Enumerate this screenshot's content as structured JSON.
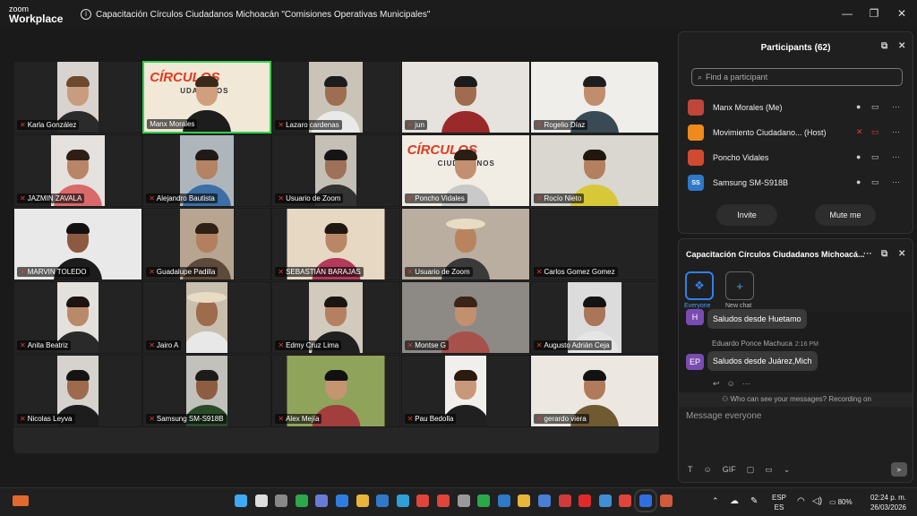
{
  "app": {
    "brand_top": "zoom",
    "brand_bottom": "Workplace",
    "title": "Capacitación Círculos Ciudadanos Michoacán \"Comisiones Operativas Municipales\""
  },
  "window_controls": {
    "minimize": "—",
    "restore": "❐",
    "close": "✕"
  },
  "tiles": [
    {
      "name": "Karla González",
      "video": "person",
      "bg": "#d8d3cf",
      "skin": "#c99b7f",
      "shirt": "#2b2b2b",
      "hair": "#6d4a2e",
      "vw": 0.32
    },
    {
      "name": "Manx Morales",
      "video": "logo",
      "bg": "#f1e8d8",
      "skin": "#d0a07e",
      "shirt": "#1d1d1d",
      "hair": "#3a2a1a",
      "vw": 1,
      "active": true,
      "logo_text": "CÍRCULOS",
      "logo_sub": "UDADANOS"
    },
    {
      "name": "Lazaro cardenas",
      "video": "person",
      "bg": "#c9c4b7",
      "skin": "#9d6e52",
      "shirt": "#e9e9e9",
      "hair": "#1c1c1c",
      "vw": 0.42
    },
    {
      "name": "jun",
      "video": "person",
      "bg": "#e6e2dd",
      "skin": "#a06b4e",
      "shirt": "#9a2a2a",
      "hair": "#1b1b1b",
      "vw": 1
    },
    {
      "name": "Rogelio Díaz",
      "video": "person",
      "bg": "#efeeea",
      "skin": "#c08d6d",
      "shirt": "#3a4a55",
      "hair": "#1e1e1e",
      "vw": 1
    },
    {
      "name": "JAZMIN ZAVALA",
      "video": "person",
      "bg": "#e4e1de",
      "skin": "#b98568",
      "shirt": "#d96a6a",
      "hair": "#2d1f15",
      "vw": 0.42
    },
    {
      "name": "Alejandro Bautista",
      "video": "person",
      "bg": "#aeb6bc",
      "skin": "#b48363",
      "shirt": "#3d6ea6",
      "hair": "#1f1a17",
      "vw": 0.42
    },
    {
      "name": "Usuario de Zoom",
      "video": "person",
      "bg": "#c4c0b6",
      "skin": "#a0715a",
      "shirt": "#333333",
      "hair": "#151515",
      "vw": 0.32
    },
    {
      "name": "Poncho Vidales",
      "video": "logo",
      "bg": "#f2ede4",
      "skin": "#c29070",
      "shirt": "#c9c9c9",
      "hair": "#2a1e14",
      "vw": 1,
      "logo_text": "CÍRCULOS",
      "logo_sub": "CIUDADANOS"
    },
    {
      "name": "Rocío Nieto",
      "video": "person",
      "bg": "#d9d7cf",
      "skin": "#b27f5f",
      "shirt": "#d7c83a",
      "hair": "#21170f",
      "vw": 1
    },
    {
      "name": "MARVIN TOLEDO",
      "video": "person",
      "bg": "#e9e9e9",
      "skin": "#8c5a40",
      "shirt": "#1c1c1c",
      "hair": "#111111",
      "vw": 1
    },
    {
      "name": "Guadalupe Padilla",
      "video": "person",
      "bg": "#b8a591",
      "skin": "#b3805f",
      "shirt": "#5c4a3a",
      "hair": "#2e2015",
      "vw": 0.42
    },
    {
      "name": "SEBASTIÁN BARAJAS",
      "video": "person",
      "bg": "#e7d8c4",
      "skin": "#b98766",
      "shirt": "#b23a5a",
      "hair": "#1f1712",
      "vw": 0.76
    },
    {
      "name": "Usuario de Zoom",
      "video": "hat",
      "bg": "#b9aea0",
      "skin": "#b8845e",
      "shirt": "#3a3a3a",
      "hair": "#e9dcc4",
      "vw": 1
    },
    {
      "name": "Carlos Gomez Gomez",
      "video": "none",
      "bg": "#262626",
      "vw": 0
    },
    {
      "name": "Anita Beatriz",
      "video": "person",
      "bg": "#e4e1dc",
      "skin": "#b98a6a",
      "shirt": "#2a2a2a",
      "hair": "#1b1410",
      "vw": 0.32
    },
    {
      "name": "Jairo A",
      "video": "hat",
      "bg": "#c9bfae",
      "skin": "#9e6b4c",
      "shirt": "#e8e8e8",
      "hair": "#e9dcc4",
      "vw": 0.32
    },
    {
      "name": "Edmy Cruz Lima",
      "video": "person",
      "bg": "#d2cbbd",
      "skin": "#b48061",
      "shirt": "#202020",
      "hair": "#1c1410",
      "vw": 0.42
    },
    {
      "name": "Montse G",
      "video": "person",
      "bg": "#8d8a86",
      "skin": "#c3906e",
      "shirt": "#a6524a",
      "hair": "#3a2416",
      "vw": 1
    },
    {
      "name": "Augusto Adrián Ceja",
      "video": "person",
      "bg": "#dcdcdc",
      "skin": "#a97658",
      "shirt": "#e5e5e5",
      "hair": "#131313",
      "vw": 0.42
    },
    {
      "name": "Nicolas Leyva",
      "video": "person",
      "bg": "#d6d3ce",
      "skin": "#9d6a4d",
      "shirt": "#1d1d1d",
      "hair": "#141414",
      "vw": 0.32
    },
    {
      "name": "Samsung SM-S918B",
      "video": "person",
      "bg": "#c3c1bc",
      "skin": "#8d5d42",
      "shirt": "#2a4a2a",
      "hair": "#1c1c1c",
      "vw": 0.32
    },
    {
      "name": "Alex Mejía",
      "video": "person",
      "bg": "#8fa45a",
      "skin": "#c59572",
      "shirt": "#a23e3e",
      "hair": "#111111",
      "vw": 0.76
    },
    {
      "name": "Pau Bedolla",
      "video": "person",
      "bg": "#f1efec",
      "skin": "#c9987a",
      "shirt": "#202020",
      "hair": "#2a1a10",
      "vw": 0.32
    },
    {
      "name": "gerardo viera",
      "video": "person",
      "bg": "#ece8e1",
      "skin": "#b07b5a",
      "shirt": "#6f5a32",
      "hair": "#121212",
      "vw": 1
    }
  ],
  "participants_panel": {
    "title": "Participants (62)",
    "search_placeholder": "Find a participant",
    "rows": [
      {
        "name": "Manx Morales (Me)",
        "avatar": "",
        "avatar_color": "#c0463a"
      },
      {
        "name": "Movimiento Ciudadano... (Host)",
        "avatar": "",
        "avatar_color": "#f08a1c"
      },
      {
        "name": "Poncho Vidales",
        "avatar": "",
        "avatar_color": "#d14a30"
      },
      {
        "name": "Samsung SM-S918B",
        "avatar": "SS",
        "avatar_color": "#2f79c8"
      }
    ],
    "invite_label": "Invite",
    "mute_me_label": "Mute me"
  },
  "chat_panel": {
    "title": "Capacitación Círculos Ciudadanos Michoacá...",
    "everyone_label": "Everyone",
    "new_chat_label": "New chat",
    "messages": [
      {
        "avatar": "H",
        "avatar_color": "#7a4cb0",
        "sender": "",
        "time": "",
        "text": "Saludos desde Huetamo"
      },
      {
        "avatar": "EP",
        "avatar_color": "#7a4cb0",
        "sender": "Eduardo Ponce Machuca",
        "time": "2:16 PM",
        "text": "Saludos desde Juárez,Mich"
      }
    ],
    "visibility_note": "Who can see your messages? Recording on",
    "composer_placeholder": "Message everyone",
    "tool_labels": [
      "T",
      "☺",
      "GIF",
      "▢",
      "▭",
      "⌄"
    ]
  },
  "taskbar": {
    "language_top": "ESP",
    "language_bottom": "ES",
    "battery": "80%",
    "time": "02:24 p. m.",
    "date": "26/03/2026"
  }
}
